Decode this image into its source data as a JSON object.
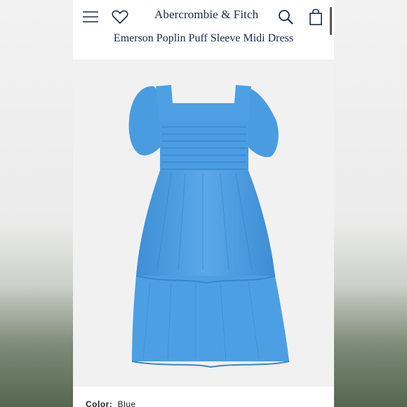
{
  "header": {
    "brand": "Abercrombie & Fitch",
    "icons": [
      "menu-icon",
      "heart-icon",
      "search-icon",
      "shopping-bag-icon"
    ]
  },
  "product": {
    "title": "Emerson Poplin Puff Sleeve Midi Dress",
    "color_label": "Color:",
    "color_value": "Blue"
  },
  "colors": {
    "brand_text": "#1b2a4a",
    "dress_blue": "#4f9fe0"
  }
}
